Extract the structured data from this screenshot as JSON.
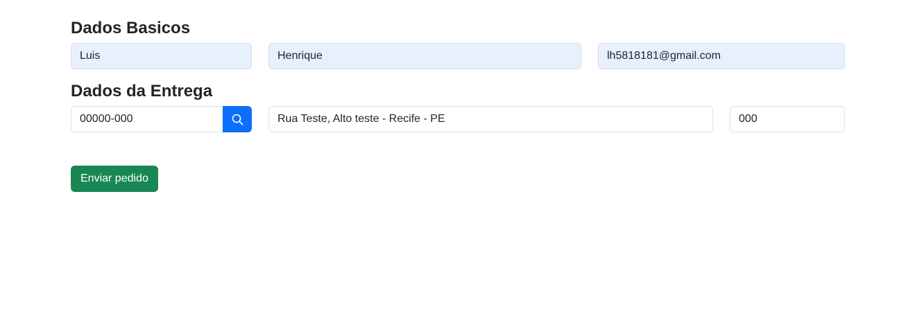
{
  "basic_section": {
    "title": "Dados Basicos",
    "first_name": "Luis",
    "last_name": "Henrique",
    "email": "lh5818181@gmail.com"
  },
  "delivery_section": {
    "title": "Dados da Entrega",
    "cep": "00000-000",
    "search_icon": "search-icon",
    "address": "Rua Teste, Alto teste - Recife - PE",
    "number": "000"
  },
  "actions": {
    "submit_label": "Enviar pedido"
  },
  "colors": {
    "primary": "#0d6efd",
    "success": "#198754",
    "autofill": "#e8f0fe"
  }
}
